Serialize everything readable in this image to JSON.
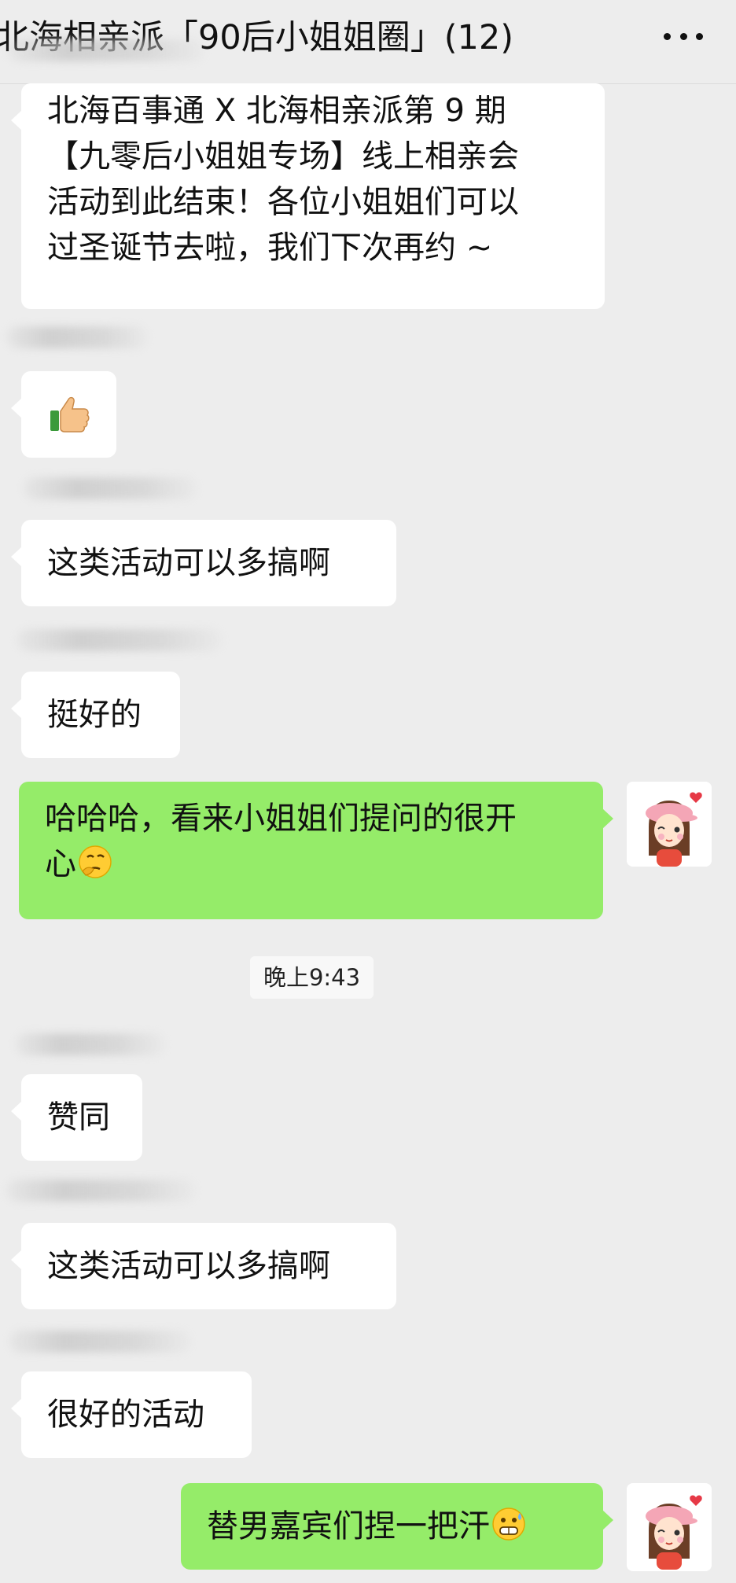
{
  "header": {
    "title": "北海相亲派「90后小姐姐圈」(12)",
    "more_icon": "more-horizontal-icon"
  },
  "messages": [
    {
      "side": "left",
      "lines": [
        "北海百事通 X 北海相亲派第 9 期",
        "【九零后小姐姐专场】线上相亲会",
        "活动到此结束！各位小姐姐们可以",
        "过圣诞节去啦，我们下次再约 ~"
      ]
    },
    {
      "side": "left",
      "icon": "thumbs-up-icon"
    },
    {
      "side": "left",
      "text": "这类活动可以多搞啊"
    },
    {
      "side": "left",
      "text": "挺好的"
    },
    {
      "side": "right",
      "lines": [
        "哈哈哈，看来小姐姐们提问的很开",
        "心"
      ],
      "icon": "thinking-face-icon",
      "avatar": "girl-avatar-icon"
    },
    {
      "side": "left",
      "text": "赞同"
    },
    {
      "side": "left",
      "text": "这类活动可以多搞啊"
    },
    {
      "side": "left",
      "text": "很好的活动"
    },
    {
      "side": "right",
      "text": "替男嘉宾们捏一把汗",
      "icon": "grimace-face-icon",
      "avatar": "girl-avatar-icon"
    }
  ],
  "timestamp": "晚上9:43",
  "colors": {
    "background": "#ededed",
    "own_bubble": "#95ec69",
    "other_bubble": "#ffffff"
  }
}
